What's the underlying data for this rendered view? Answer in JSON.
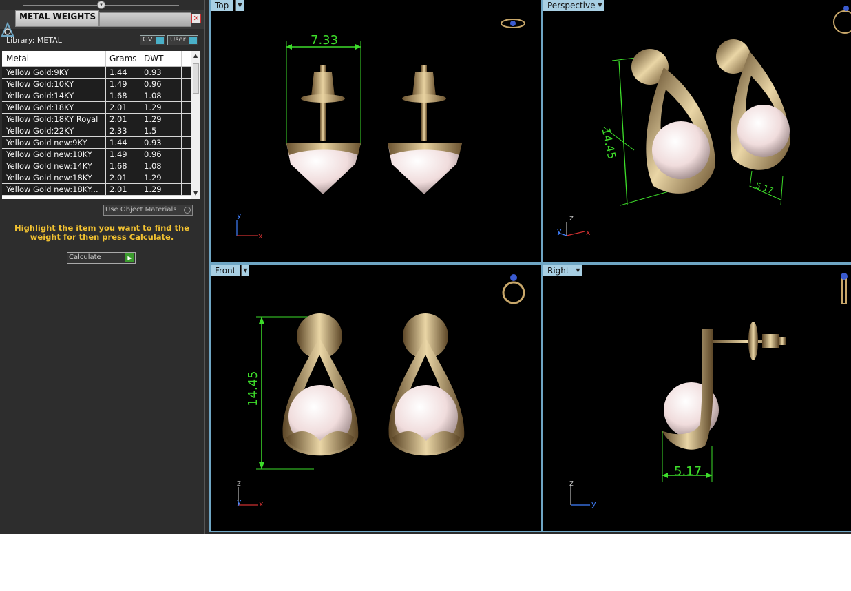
{
  "panel": {
    "title": "METAL WEIGHTS",
    "close_label": "✕",
    "library_label": "Library: METAL",
    "gv_label": "GV",
    "user_label": "User",
    "toggle_glyph": "I",
    "columns": [
      "Metal",
      "Grams",
      "DWT"
    ],
    "rows": [
      {
        "metal": "Yellow Gold:9KY",
        "grams": "1.44",
        "dwt": "0.93"
      },
      {
        "metal": "Yellow Gold:10KY",
        "grams": "1.49",
        "dwt": "0.96"
      },
      {
        "metal": "Yellow Gold:14KY",
        "grams": "1.68",
        "dwt": "1.08"
      },
      {
        "metal": "Yellow Gold:18KY",
        "grams": "2.01",
        "dwt": "1.29"
      },
      {
        "metal": "Yellow Gold:18KY Royal",
        "grams": "2.01",
        "dwt": "1.29"
      },
      {
        "metal": "Yellow Gold:22KY",
        "grams": "2.33",
        "dwt": "1.5"
      },
      {
        "metal": "Yellow Gold new:9KY",
        "grams": "1.44",
        "dwt": "0.93"
      },
      {
        "metal": "Yellow Gold new:10KY",
        "grams": "1.49",
        "dwt": "0.96"
      },
      {
        "metal": "Yellow Gold new:14KY",
        "grams": "1.68",
        "dwt": "1.08"
      },
      {
        "metal": "Yellow Gold new:18KY",
        "grams": "2.01",
        "dwt": "1.29"
      },
      {
        "metal": "Yellow Gold new:18KY...",
        "grams": "2.01",
        "dwt": "1.29"
      }
    ],
    "use_object_materials": "Use Object Materials",
    "hint": "Highlight the item you want to find the weight for then press Calculate.",
    "calculate_label": "Calculate",
    "colors": {
      "hint": "#f2c231",
      "calc_arrow": "#3b9b2d",
      "toggle": "#4ab0c8"
    }
  },
  "viewports": {
    "top": {
      "label": "Top",
      "dimension": "7.33"
    },
    "perspective": {
      "label": "Perspective",
      "dimension_a": "14.45",
      "dimension_b": "5.17"
    },
    "front": {
      "label": "Front",
      "dimension": "14.45"
    },
    "right": {
      "label": "Right",
      "dimension": "5.17"
    },
    "axes": {
      "x": "x",
      "y": "y",
      "z": "z"
    },
    "colors": {
      "dimension": "#3ddc2a",
      "gold": "#c8a76a",
      "pearl": "#f0dcdc",
      "tab": "#a8cfe3",
      "divider": "#6fa6c4"
    }
  }
}
